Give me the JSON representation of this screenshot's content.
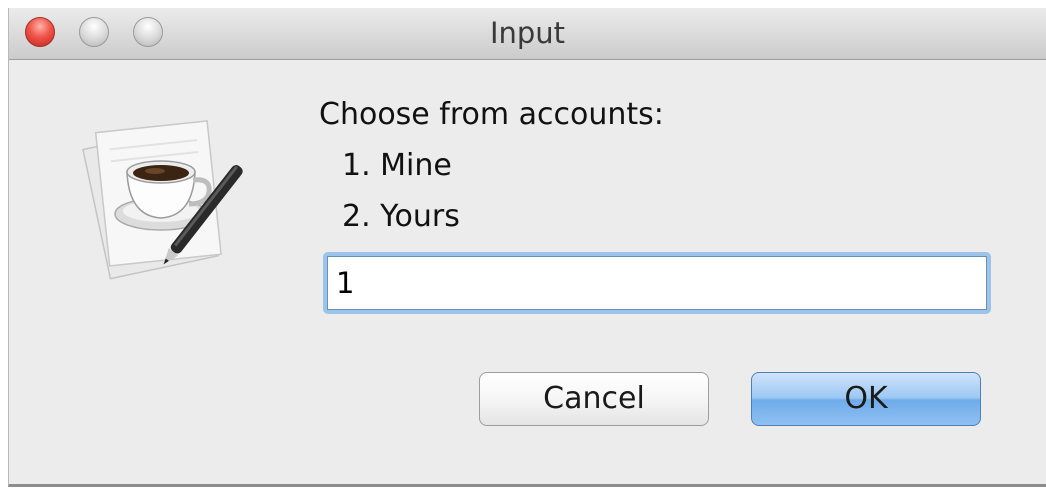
{
  "window": {
    "title": "Input"
  },
  "titlebar": {
    "buttons": [
      {
        "name": "close",
        "color": "#f0544a"
      },
      {
        "name": "minimize",
        "color": "#d0d0d0"
      },
      {
        "name": "zoom",
        "color": "#d0d0d0"
      }
    ]
  },
  "icon": {
    "name": "java-coffee-cup-icon"
  },
  "dialog": {
    "prompt": "Choose from accounts:",
    "options": [
      "1.  Mine",
      "2.  Yours"
    ],
    "input": {
      "value": "1"
    },
    "buttons": {
      "cancel_label": "Cancel",
      "ok_label": "OK"
    }
  },
  "colors": {
    "window_bg": "#ececec",
    "focus_ring": "#9cc3ea",
    "default_button": "#8fc0f2"
  }
}
